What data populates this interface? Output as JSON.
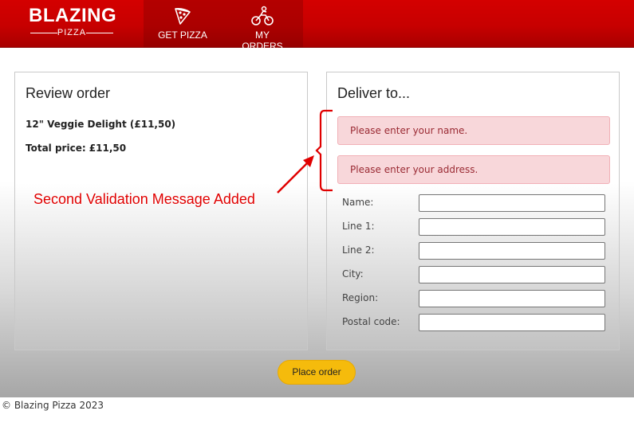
{
  "header": {
    "logo_main": "BLAZING",
    "logo_sub": "PIZZA",
    "nav": [
      {
        "label": "GET PIZZA",
        "icon": "pizza-slice-icon"
      },
      {
        "label": "MY ORDERS",
        "icon": "motorbike-icon"
      }
    ]
  },
  "review": {
    "title": "Review order",
    "items": [
      "12\" Veggie Delight (£11,50)"
    ],
    "total": "Total price: £11,50"
  },
  "deliver": {
    "title": "Deliver to...",
    "validation_messages": [
      "Please enter your name.",
      "Please enter your address."
    ],
    "fields": [
      {
        "label": "Name:",
        "value": ""
      },
      {
        "label": "Line 1:",
        "value": ""
      },
      {
        "label": "Line 2:",
        "value": ""
      },
      {
        "label": "City:",
        "value": ""
      },
      {
        "label": "Region:",
        "value": ""
      },
      {
        "label": "Postal code:",
        "value": ""
      }
    ]
  },
  "place_order_label": "Place order",
  "footer": "© Blazing Pizza 2023",
  "annotation": {
    "text": "Second Validation Message Added",
    "color": "#e00000"
  },
  "colors": {
    "header_red": "#c70000",
    "button_yellow": "#f5bb0c",
    "alert_bg": "#f8d7da"
  }
}
